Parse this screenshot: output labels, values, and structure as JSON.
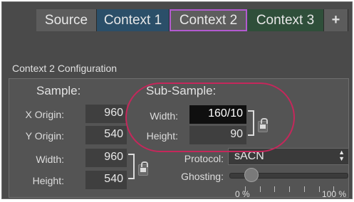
{
  "tabs": [
    {
      "label": "Source",
      "active": false
    },
    {
      "label": "Context 1",
      "active": false
    },
    {
      "label": "Context 2",
      "active": true
    },
    {
      "label": "Context 3",
      "active": false
    }
  ],
  "add_tab_label": "+",
  "section_title": "Context 2 Configuration",
  "sample": {
    "heading": "Sample:",
    "x_origin": {
      "label": "X Origin:",
      "value": "960"
    },
    "y_origin": {
      "label": "Y Origin:",
      "value": "540"
    },
    "width": {
      "label": "Width:",
      "value": "960"
    },
    "height": {
      "label": "Height:",
      "value": "540"
    }
  },
  "subsample": {
    "heading": "Sub-Sample:",
    "width": {
      "label": "Width:",
      "value": "160/10"
    },
    "height": {
      "label": "Height:",
      "value": "90"
    }
  },
  "protocol": {
    "label": "Protocol:",
    "value": "sACN"
  },
  "ghosting": {
    "label": "Ghosting:",
    "value_fraction": 0.15,
    "min_label": "0 %",
    "max_label": "100 %"
  },
  "colors": {
    "active_tab_border": "#b35ad0",
    "highlight_annotation": "#c5275b",
    "context1_tab": "#2b4f69",
    "context3_tab": "#2f4f3a"
  }
}
